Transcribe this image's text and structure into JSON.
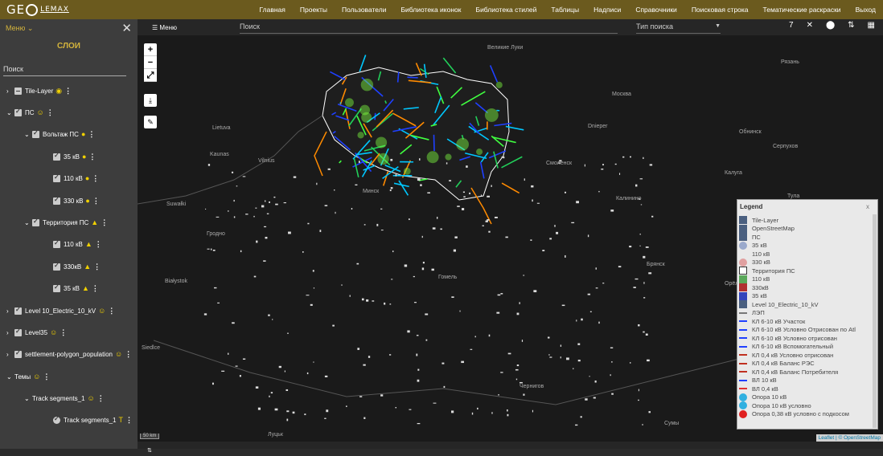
{
  "app": {
    "logo_text": "GE",
    "logo_sub": "LEMAX"
  },
  "nav": [
    "Главная",
    "Проекты",
    "Пользователи",
    "Библиотека иконок",
    "Библиотека стилей",
    "Таблицы",
    "Надписи",
    "Справочники",
    "Поисковая строка",
    "Тематические раскраски",
    "Выход"
  ],
  "sidebar": {
    "menu_label": "Меню ⌄",
    "close": "✕",
    "title": "СЛОИ",
    "search_placeholder": "Поиск",
    "tree": [
      {
        "label": "Tile-Layer"
      },
      {
        "label": "ПС"
      },
      {
        "label": "Вольтаж ПС"
      },
      {
        "label": "35 кВ"
      },
      {
        "label": "110 кВ"
      },
      {
        "label": "330 кВ"
      },
      {
        "label": "Территория ПС"
      },
      {
        "label": "110 кВ"
      },
      {
        "label": "330кВ"
      },
      {
        "label": "35 кВ"
      },
      {
        "label": "Level 10_Electric_10_kV"
      },
      {
        "label": "Level35"
      },
      {
        "label": "settlement-polygon_population"
      },
      {
        "label": "Темы"
      },
      {
        "label": "Track segments_1"
      },
      {
        "label": "Track segments_1"
      }
    ]
  },
  "mapbar": {
    "menu": "☰ Меню",
    "search": "Поиск",
    "type": "Тип поиска",
    "count": "7"
  },
  "map": {
    "zoom_in": "+",
    "zoom_out": "−",
    "cities": [
      "Lietuva",
      "Vilnius",
      "Kaunas",
      "Гродно",
      "Białystok",
      "Смоленск",
      "Калуга",
      "Москва",
      "Брянск",
      "Орёл",
      "Минск",
      "Гомель",
      "Чернигов",
      "Сумы",
      "Луцьк",
      "Siedlce",
      "Suwałki",
      "Великие Луки",
      "Тула",
      "Рязань",
      "Серпухов",
      "Обнинск",
      "Dnieper",
      "Калинино"
    ],
    "scale": "50 km",
    "attribution": "Leaflet | © OpenStreetMap"
  },
  "legend": {
    "title": "Legend",
    "close": "x",
    "items": [
      {
        "label": "Tile-Layer",
        "color": "#4a5f7f",
        "kind": "box"
      },
      {
        "label": "OpenStreetMap",
        "color": "#4a5f7f",
        "kind": "box"
      },
      {
        "label": "ПС",
        "color": "#4a5f7f",
        "kind": "box"
      },
      {
        "label": "35 кВ",
        "color": "#9aa9cc",
        "kind": "circle"
      },
      {
        "label": "110 кВ",
        "color": "#e9e9e9",
        "kind": "circle"
      },
      {
        "label": "330 кВ",
        "color": "#e0a0a0",
        "kind": "circle"
      },
      {
        "label": "Территория ПС",
        "color": "#ffffff",
        "kind": "outline"
      },
      {
        "label": "110 кВ",
        "color": "#5aa85a",
        "kind": "box"
      },
      {
        "label": "330кВ",
        "color": "#b03030",
        "kind": "box"
      },
      {
        "label": "35 кВ",
        "color": "#3344bb",
        "kind": "box"
      },
      {
        "label": "Level 10_Electric_10_kV",
        "color": "#4a5f7f",
        "kind": "box"
      },
      {
        "label": "ЛЭП",
        "color": "#777777",
        "kind": "line"
      },
      {
        "label": "КЛ 6-10 кВ Участок",
        "color": "#2040ff",
        "kind": "line"
      },
      {
        "label": "КЛ 6-10 кВ Условно Отрисован по Atl",
        "color": "#2040ff",
        "kind": "line"
      },
      {
        "label": "КЛ 6-10 кВ Условно отрисован",
        "color": "#2040ff",
        "kind": "line"
      },
      {
        "label": "КЛ 6-10 кВ Вспомогательный",
        "color": "#2040ff",
        "kind": "line"
      },
      {
        "label": "КЛ 0,4 кВ Условно отрисован",
        "color": "#c03020",
        "kind": "line"
      },
      {
        "label": "КЛ 0,4 кВ Баланс РЭС",
        "color": "#c03020",
        "kind": "line"
      },
      {
        "label": "КЛ 0,4 кВ Баланс Потребителя",
        "color": "#c03020",
        "kind": "line"
      },
      {
        "label": "ВЛ 10 кВ",
        "color": "#2040ff",
        "kind": "line"
      },
      {
        "label": "ВЛ 0,4 кВ",
        "color": "#e03030",
        "kind": "line"
      },
      {
        "label": "Опора 10 кВ",
        "color": "#30b0e0",
        "kind": "circle"
      },
      {
        "label": "Опора 10 кВ условно",
        "color": "#30b0e0",
        "kind": "circle"
      },
      {
        "label": "Опора 0,38 кВ условно с подкосом",
        "color": "#e02020",
        "kind": "circle"
      }
    ]
  }
}
